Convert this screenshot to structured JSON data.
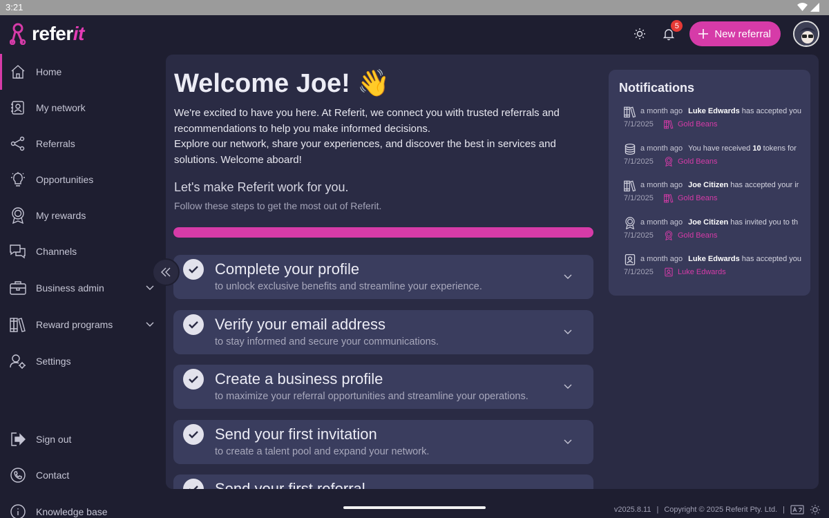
{
  "status_bar": {
    "time": "3:21"
  },
  "brand": {
    "name_main": "refer",
    "name_accent": "it",
    "accent_color": "#d63ba8"
  },
  "header": {
    "notification_count": "5",
    "new_referral_label": "New referral"
  },
  "sidebar": {
    "items": [
      {
        "label": "Home",
        "icon": "home-icon",
        "active": true
      },
      {
        "label": "My network",
        "icon": "contacts-icon"
      },
      {
        "label": "Referrals",
        "icon": "share-icon"
      },
      {
        "label": "Opportunities",
        "icon": "lightbulb-icon"
      },
      {
        "label": "My rewards",
        "icon": "award-icon"
      },
      {
        "label": "Channels",
        "icon": "chat-icon"
      },
      {
        "label": "Business admin",
        "icon": "briefcase-icon",
        "expandable": true
      },
      {
        "label": "Reward programs",
        "icon": "books-icon",
        "expandable": true
      },
      {
        "label": "Settings",
        "icon": "user-settings-icon"
      }
    ],
    "bottom_items": [
      {
        "label": "Sign out",
        "icon": "sign-out-icon"
      },
      {
        "label": "Contact",
        "icon": "phone-icon"
      },
      {
        "label": "Knowledge base",
        "icon": "info-icon"
      }
    ]
  },
  "welcome": {
    "title": "Welcome Joe! 👋",
    "intro": "We're excited to have you here. At Referit, we connect you with trusted referrals and recommendations to help you make informed decisions.\nExplore our network, share your experiences, and discover the best in services and solutions. Welcome aboard!",
    "subheading": "Let's make Referit work for you.",
    "subtext": "Follow these steps to get the most out of Referit.",
    "progress_fraction": 1.0
  },
  "steps": [
    {
      "title": "Complete your profile",
      "desc": "to unlock exclusive benefits and streamline your experience.",
      "done": true
    },
    {
      "title": "Verify your email address",
      "desc": "to stay informed and secure your communications.",
      "done": true
    },
    {
      "title": "Create a business profile",
      "desc": "to maximize your referral opportunities and streamline your operations.",
      "done": true
    },
    {
      "title": "Send your first invitation",
      "desc": "to create a talent pool and expand your network.",
      "done": true
    },
    {
      "title": "Send your first referral",
      "desc": "",
      "done": true
    }
  ],
  "notifications": {
    "title": "Notifications",
    "items": [
      {
        "icon": "books-icon",
        "when": "a month ago",
        "actor": "Luke Edwards",
        "text": " has accepted you",
        "date": "7/1/2025",
        "source_icon": "books-icon",
        "source": "Gold Beans"
      },
      {
        "icon": "coins-icon",
        "when": "a month ago",
        "actor": "",
        "text": "You have received <b>10</b> tokens for",
        "date": "7/1/2025",
        "source_icon": "award-icon",
        "source": "Gold Beans"
      },
      {
        "icon": "books-icon",
        "when": "a month ago",
        "actor": "Joe Citizen",
        "text": " has accepted your ir",
        "date": "7/1/2025",
        "source_icon": "books-icon",
        "source": "Gold Beans"
      },
      {
        "icon": "award-icon",
        "when": "a month ago",
        "actor": "Joe Citizen",
        "text": " has invited you to th",
        "date": "7/1/2025",
        "source_icon": "award-icon",
        "source": "Gold Beans"
      },
      {
        "icon": "contacts-icon",
        "when": "a month ago",
        "actor": "Luke Edwards",
        "text": " has accepted you",
        "date": "7/1/2025",
        "source_icon": "contacts-icon",
        "source": "Luke Edwards"
      }
    ]
  },
  "footer": {
    "version": "v2025.8.11",
    "copyright": "Copyright © 2025 Referit Pty. Ltd."
  }
}
